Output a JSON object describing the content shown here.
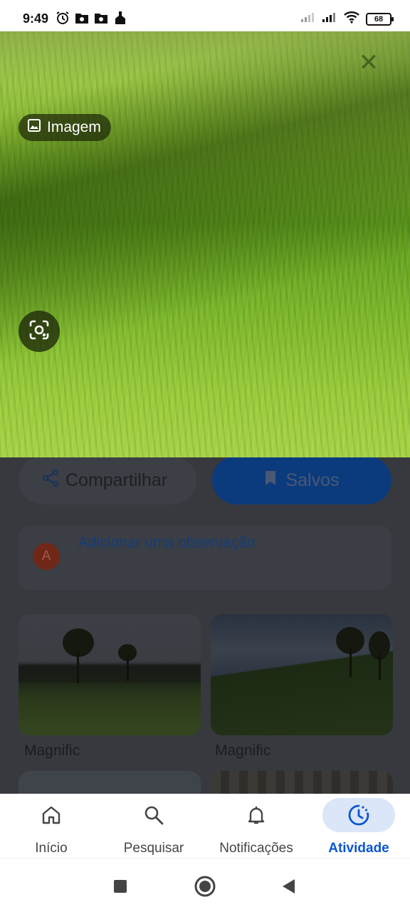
{
  "status_bar": {
    "time": "9:49",
    "battery": "68",
    "left_icons": [
      "alarm-icon",
      "folder-icon",
      "folder-icon",
      "cleaner-icon"
    ],
    "right_icons": [
      "signal-weak-icon",
      "signal-icon",
      "wifi-icon",
      "battery-icon"
    ]
  },
  "hero": {
    "chip_label": "Imagem",
    "close_icon": "close-icon",
    "lens_icon": "lens-search-icon"
  },
  "actions": {
    "share_label": "Compartilhar",
    "saved_label": "Salvos"
  },
  "note": {
    "avatar_letter": "A",
    "placeholder": "Adicionar uma observação"
  },
  "results": [
    {
      "label": "Magnific"
    },
    {
      "label": "Magnific"
    }
  ],
  "bottom_nav": [
    {
      "label": "Início",
      "icon": "home-icon",
      "active": false
    },
    {
      "label": "Pesquisar",
      "icon": "search-icon",
      "active": false
    },
    {
      "label": "Notificações",
      "icon": "bell-icon",
      "active": false
    },
    {
      "label": "Atividade",
      "icon": "activity-icon",
      "active": true
    }
  ],
  "system_nav": [
    "recents-icon",
    "home-circle-icon",
    "back-icon"
  ],
  "colors": {
    "accent": "#0b57d0",
    "active_tab_bg": "#dbe6f8",
    "overlay": "#37393e"
  }
}
